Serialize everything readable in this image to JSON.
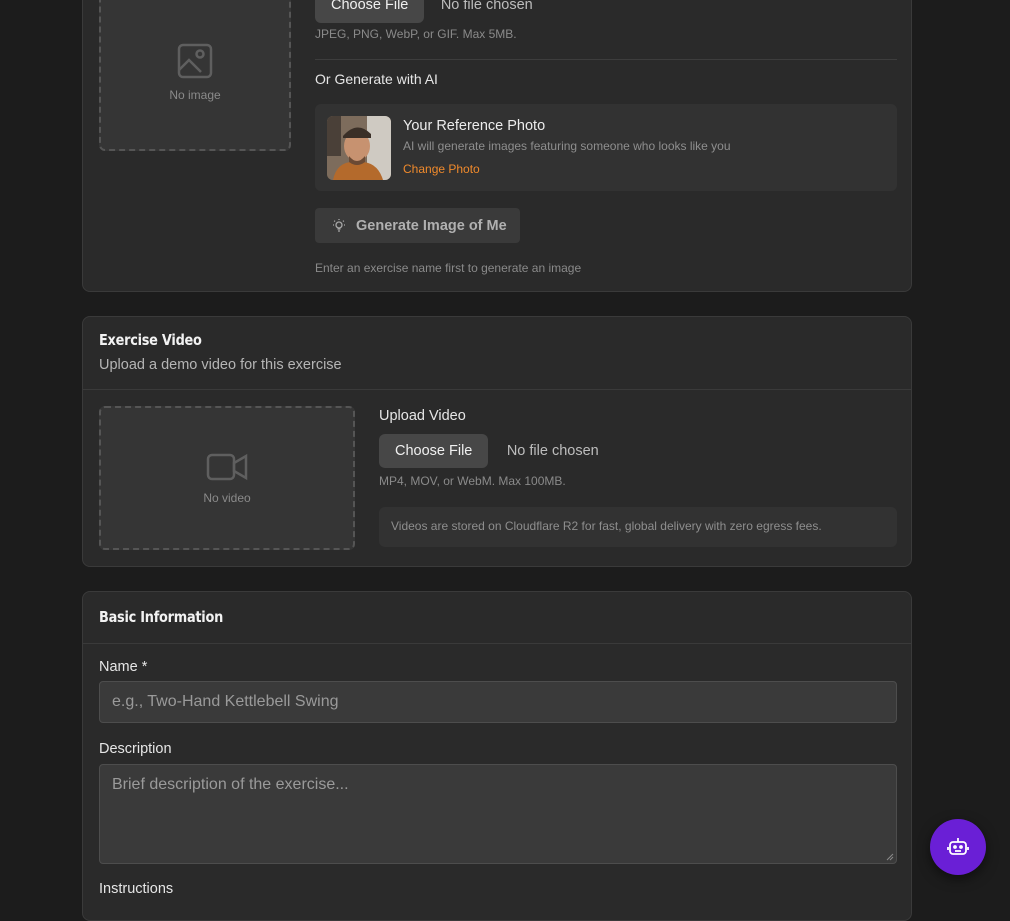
{
  "image_section": {
    "preview_empty_label": "No image",
    "choose_file_label": "Choose File",
    "no_file_label": "No file chosen",
    "formats_hint": "JPEG, PNG, WebP, or GIF. Max 5MB.",
    "ai_heading": "Or Generate with AI",
    "reference_title": "Your Reference Photo",
    "reference_desc": "AI will generate images featuring someone who looks like you",
    "change_photo_label": "Change Photo",
    "generate_label": "Generate Image of Me",
    "generate_hint": "Enter an exercise name first to generate an image"
  },
  "video_section": {
    "title": "Exercise Video",
    "subtitle": "Upload a demo video for this exercise",
    "preview_empty_label": "No video",
    "upload_label": "Upload Video",
    "choose_file_label": "Choose File",
    "no_file_label": "No file chosen",
    "formats_hint": "MP4, MOV, or WebM. Max 100MB.",
    "storage_note": "Videos are stored on Cloudflare R2 for fast, global delivery with zero egress fees."
  },
  "basic_section": {
    "title": "Basic Information",
    "name_label": "Name *",
    "name_placeholder": "e.g., Two-Hand Kettlebell Swing",
    "description_label": "Description",
    "description_placeholder": "Brief description of the exercise...",
    "instructions_label": "Instructions"
  },
  "colors": {
    "accent_orange": "#f08a2c",
    "fab_purple": "#6a1fd6"
  },
  "icons": {
    "image_placeholder": "image-icon",
    "video_placeholder": "video-camera-icon",
    "generate": "lightbulb-icon",
    "assistant": "robot-icon"
  }
}
